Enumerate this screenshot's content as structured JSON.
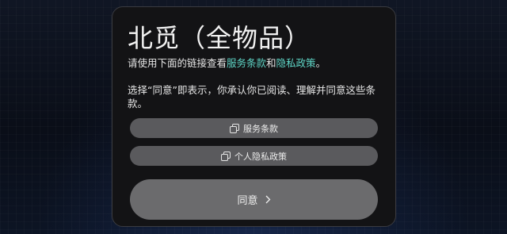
{
  "dialog": {
    "title": "北觅（全物品）",
    "intro": {
      "prefix": "请使用下面的链接查看",
      "link_terms": "服务条款",
      "middle": "和",
      "link_privacy": "隐私政策",
      "suffix": "。"
    },
    "consent_text": "选择“同意”即表示，你承认你已阅读、理解并同意这些条款。",
    "terms_button": {
      "label": "服务条款",
      "icon": "copy-icon"
    },
    "privacy_button": {
      "label": "个人隐私政策",
      "icon": "copy-icon"
    },
    "agree_button": {
      "label": "同意",
      "icon": "chevron-right-icon"
    }
  },
  "colors": {
    "background": "#0b0f19",
    "dialog": "#131315",
    "link": "#5fd6c7",
    "pill": "#5a5a5d",
    "agree": "#6b6b6d"
  }
}
